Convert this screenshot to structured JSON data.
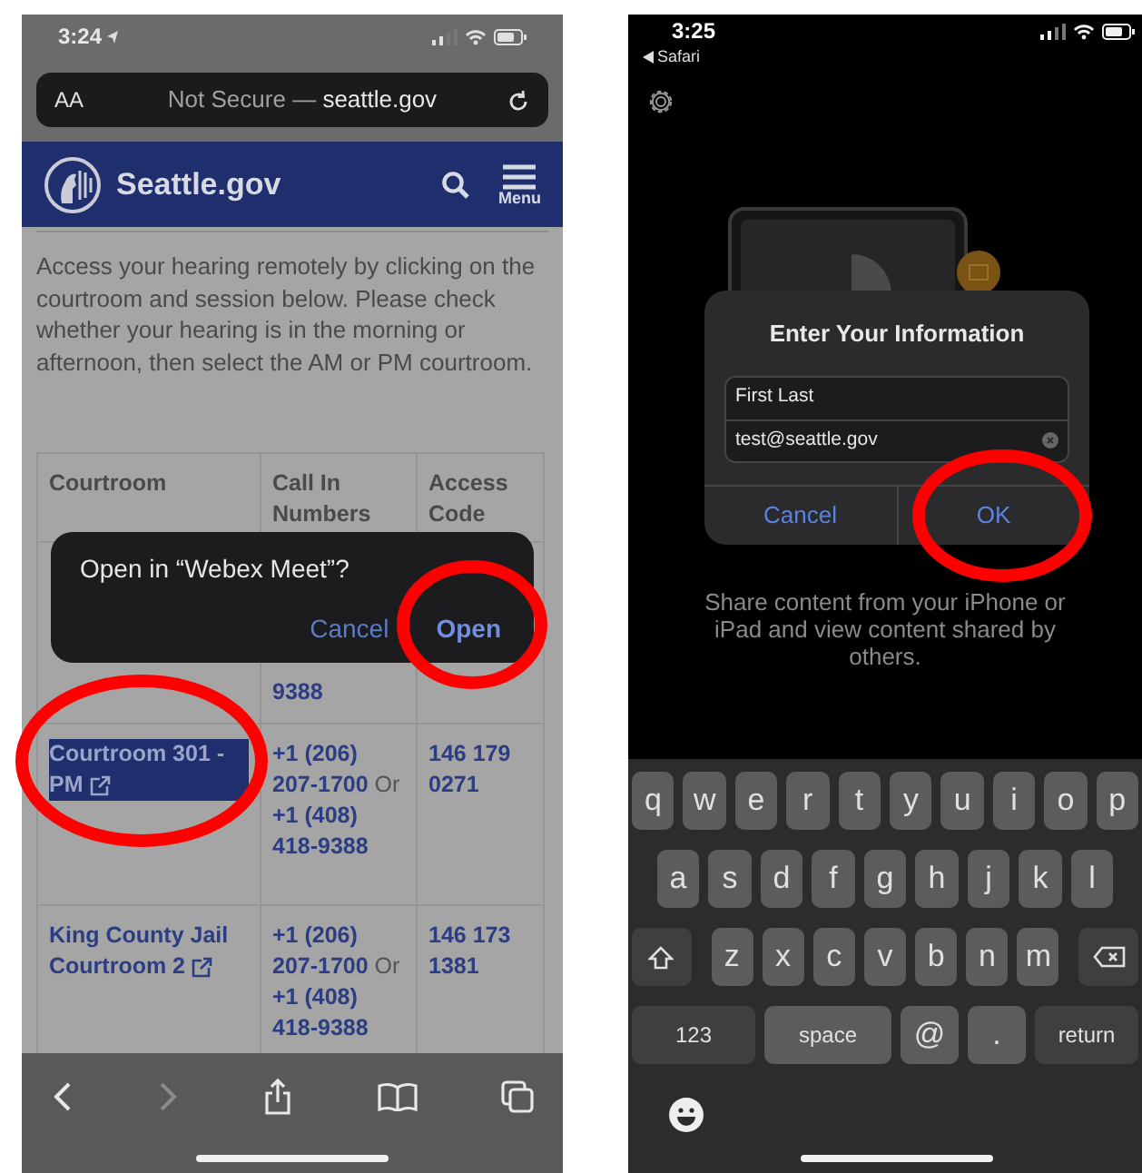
{
  "left_phone": {
    "status_bar": {
      "time": "3:24"
    },
    "address_bar": {
      "text_size_button": "AA",
      "prefix": "Not Secure — ",
      "domain": "seattle.gov"
    },
    "site_header": {
      "title": "Seattle.gov",
      "menu_label": "Menu"
    },
    "intro": "Access your hearing remotely by clicking on the courtroom and session below. Please check whether your hearing is in the morning or afternoon, then select the AM or PM courtroom.",
    "table": {
      "columns": [
        "Courtroom",
        "Call In Numbers",
        "Access Code"
      ],
      "rows": [
        {
          "call_in": "**9388**"
        },
        {
          "courtroom": "Courtroom 301 - PM",
          "call_in": "**+1 (206) 207-1700** Or **+1 (408) 418-9388**",
          "access_code": "146 179 0271",
          "highlighted": true
        },
        {
          "courtroom": "King County Jail Courtroom 2",
          "call_in": "**+1 (206) 207-1700** Or **+1 (408) 418-9388**",
          "access_code": "146 173 1381",
          "highlighted": false
        }
      ]
    },
    "dialog": {
      "message": "Open in “Webex Meet”?",
      "buttons": [
        {
          "label": "Cancel",
          "kind": "normal"
        },
        {
          "label": "Open",
          "kind": "bold"
        }
      ]
    }
  },
  "right_phone": {
    "status_bar": {
      "time": "3:25",
      "back_label": "Safari"
    },
    "dialog": {
      "title": "Enter Your Information",
      "fields": [
        {
          "value": "First Last",
          "clear_button": false
        },
        {
          "value": "test@seattle.gov",
          "clear_button": true
        }
      ],
      "buttons": [
        "Cancel",
        "OK"
      ]
    },
    "caption": "Share content from your iPhone or iPad and view content shared by others.",
    "keyboard": {
      "rows": [
        {
          "keys": [
            {
              "label": "q",
              "kind": "letter"
            },
            {
              "label": "w",
              "kind": "letter"
            },
            {
              "label": "e",
              "kind": "letter"
            },
            {
              "label": "r",
              "kind": "letter"
            },
            {
              "label": "t",
              "kind": "letter"
            },
            {
              "label": "y",
              "kind": "letter"
            },
            {
              "label": "u",
              "kind": "letter"
            },
            {
              "label": "i",
              "kind": "letter"
            },
            {
              "label": "o",
              "kind": "letter"
            },
            {
              "label": "p",
              "kind": "letter"
            }
          ]
        },
        {
          "keys": [
            {
              "label": "a",
              "kind": "letter"
            },
            {
              "label": "s",
              "kind": "letter"
            },
            {
              "label": "d",
              "kind": "letter"
            },
            {
              "label": "f",
              "kind": "letter"
            },
            {
              "label": "g",
              "kind": "letter"
            },
            {
              "label": "h",
              "kind": "letter"
            },
            {
              "label": "j",
              "kind": "letter"
            },
            {
              "label": "k",
              "kind": "letter"
            },
            {
              "label": "l",
              "kind": "letter"
            }
          ]
        },
        {
          "keys": [
            {
              "kind": "shift"
            },
            {
              "label": "z",
              "kind": "letter"
            },
            {
              "label": "x",
              "kind": "letter"
            },
            {
              "label": "c",
              "kind": "letter"
            },
            {
              "label": "v",
              "kind": "letter"
            },
            {
              "label": "b",
              "kind": "letter"
            },
            {
              "label": "n",
              "kind": "letter"
            },
            {
              "label": "m",
              "kind": "letter"
            },
            {
              "kind": "delete"
            }
          ]
        },
        {
          "keys": [
            {
              "label": "123",
              "kind": "function"
            },
            {
              "label": "space",
              "kind": "space"
            },
            {
              "label": "@",
              "kind": "letter"
            },
            {
              "label": ".",
              "kind": "letter"
            },
            {
              "label": "return",
              "kind": "function"
            }
          ]
        }
      ]
    }
  }
}
